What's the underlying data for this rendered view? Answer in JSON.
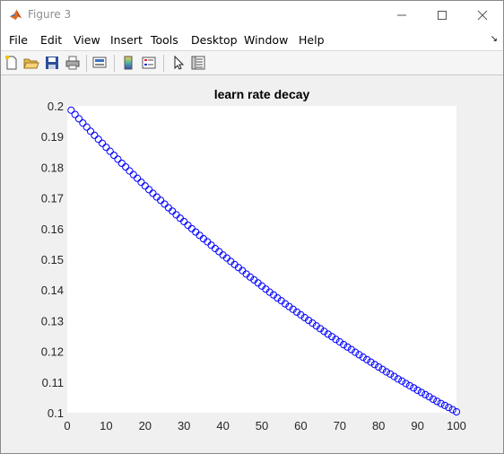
{
  "window": {
    "title": "Figure 3",
    "minimize_icon": "minimize-icon",
    "maximize_icon": "maximize-icon",
    "close_icon": "close-icon"
  },
  "menu": {
    "items": [
      "File",
      "Edit",
      "View",
      "Insert",
      "Tools",
      "Desktop",
      "Window",
      "Help"
    ]
  },
  "toolbar": {
    "buttons": [
      "new-figure-icon",
      "open-file-icon",
      "save-icon",
      "print-icon",
      "link-plot-icon",
      "insert-colorbar-icon",
      "insert-legend-icon",
      "edit-plot-pointer-icon",
      "property-inspector-icon"
    ]
  },
  "colors": {
    "marker": "#0000ff",
    "axes_bg": "#ffffff",
    "figure_bg": "#f0f0f0"
  },
  "chart_data": {
    "type": "scatter",
    "title": "learn rate decay",
    "xlabel": "",
    "ylabel": "",
    "xlim": [
      0,
      100
    ],
    "ylim": [
      0.1,
      0.2
    ],
    "xticks": [
      0,
      10,
      20,
      30,
      40,
      50,
      60,
      70,
      80,
      90,
      100
    ],
    "yticks": [
      0.1,
      0.11,
      0.12,
      0.13,
      0.14,
      0.15,
      0.16,
      0.17,
      0.18,
      0.19,
      0.2
    ],
    "ytick_labels": [
      "0.1",
      "0.11",
      "0.12",
      "0.13",
      "0.14",
      "0.15",
      "0.16",
      "0.17",
      "0.18",
      "0.19",
      "0.2"
    ],
    "marker": "circle",
    "grid": false,
    "x": [
      1,
      2,
      3,
      4,
      5,
      6,
      7,
      8,
      9,
      10,
      11,
      12,
      13,
      14,
      15,
      16,
      17,
      18,
      19,
      20,
      21,
      22,
      23,
      24,
      25,
      26,
      27,
      28,
      29,
      30,
      31,
      32,
      33,
      34,
      35,
      36,
      37,
      38,
      39,
      40,
      41,
      42,
      43,
      44,
      45,
      46,
      47,
      48,
      49,
      50,
      51,
      52,
      53,
      54,
      55,
      56,
      57,
      58,
      59,
      60,
      61,
      62,
      63,
      64,
      65,
      66,
      67,
      68,
      69,
      70,
      71,
      72,
      73,
      74,
      75,
      76,
      77,
      78,
      79,
      80,
      81,
      82,
      83,
      84,
      85,
      86,
      87,
      88,
      89,
      90,
      91,
      92,
      93,
      94,
      95,
      96,
      97,
      98,
      99,
      100
    ],
    "y": [
      0.1986,
      0.1972,
      0.1958,
      0.1944,
      0.1931,
      0.1917,
      0.1904,
      0.1891,
      0.1878,
      0.1865,
      0.1852,
      0.1839,
      0.1826,
      0.1813,
      0.1801,
      0.1788,
      0.1776,
      0.1764,
      0.1751,
      0.1739,
      0.1727,
      0.1715,
      0.1703,
      0.1692,
      0.168,
      0.1668,
      0.1657,
      0.1645,
      0.1634,
      0.1623,
      0.1611,
      0.16,
      0.1589,
      0.1578,
      0.1567,
      0.1557,
      0.1546,
      0.1535,
      0.1525,
      0.1514,
      0.1504,
      0.1493,
      0.1483,
      0.1473,
      0.1463,
      0.1452,
      0.1442,
      0.1433,
      0.1423,
      0.1413,
      0.1403,
      0.1393,
      0.1384,
      0.1374,
      0.1365,
      0.1355,
      0.1346,
      0.1337,
      0.1328,
      0.1319,
      0.131,
      0.1301,
      0.1292,
      0.1283,
      0.1274,
      0.1265,
      0.1256,
      0.1248,
      0.1239,
      0.1231,
      0.1222,
      0.1214,
      0.1206,
      0.1197,
      0.1189,
      0.1181,
      0.1173,
      0.1165,
      0.1157,
      0.1149,
      0.1141,
      0.1133,
      0.1126,
      0.1118,
      0.111,
      0.1103,
      0.1095,
      0.1088,
      0.1081,
      0.1073,
      0.1066,
      0.1059,
      0.1052,
      0.1044,
      0.1037,
      0.103,
      0.1024,
      0.1017,
      0.101,
      0.1003
    ]
  }
}
